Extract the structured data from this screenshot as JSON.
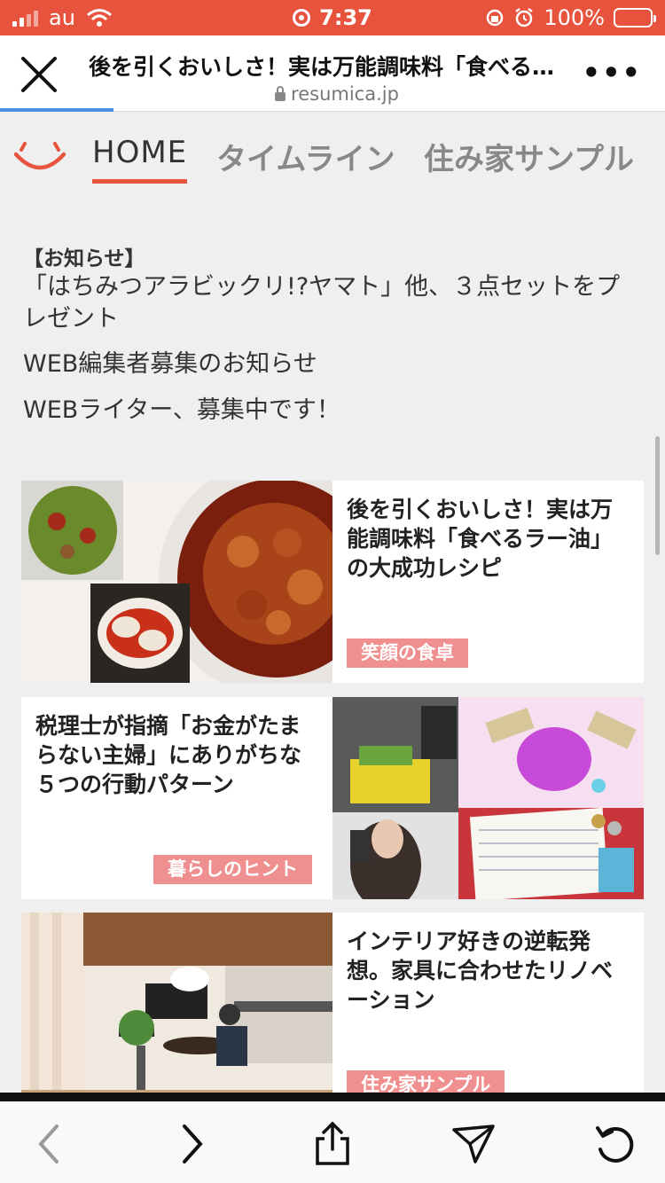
{
  "status_bar": {
    "carrier": "au",
    "time": "7:37",
    "battery": "100%"
  },
  "browser": {
    "page_title": "後を引くおいしさ！実は万能調味料「食べる…",
    "domain": "resumica.jp",
    "more_label": "•••",
    "load_progress": 0.17
  },
  "nav": {
    "home": "HOME",
    "timeline": "タイムライン",
    "samples": "住み家サンプル"
  },
  "notices": {
    "tag": "【お知らせ】",
    "item1": "「はちみつアラビックリ!?ヤマト」他、３点セットをプレゼント",
    "item2": "WEB編集者募集のお知らせ",
    "item3": "WEBライター、募集中です！"
  },
  "articles": [
    {
      "title": "後を引くおいしさ！実は万能調味料「食べるラー油」の大成功レシピ",
      "category": "笑顔の食卓"
    },
    {
      "title": "税理士が指摘「お金がたまらない主婦」にありがちな５つの行動パターン",
      "category": "暮らしのヒント"
    },
    {
      "title": "インテリア好きの逆転発想。家具に合わせたリノベーション",
      "category": "住み家サンプル"
    }
  ],
  "colors": {
    "brand": "#e8533d",
    "tag_bg": "#f08f8f",
    "progress": "#4a90e2"
  }
}
